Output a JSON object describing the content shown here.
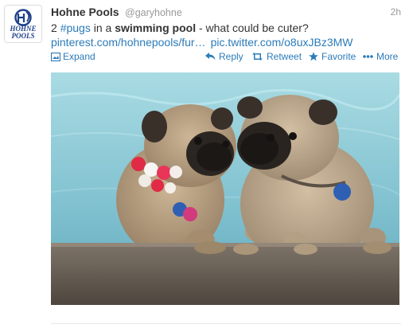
{
  "tweet": {
    "fullname": "Hohne Pools",
    "username": "@garyhohne",
    "timestamp": "2h",
    "avatar_icon": "hohne-pools-logo",
    "avatar_text_line1": "HOHNE",
    "avatar_text_line2": "POOLS",
    "text_prefix": "2 ",
    "hashtag": "#pugs",
    "text_mid": " in a ",
    "text_bold": "swimming pool",
    "text_suffix": " - what could be cuter?",
    "link_url": "pinterest.com/hohnepools/fur…",
    "link_pic": "pic.twitter.com/o8uxJBz3MW",
    "link_color": "#2b7bb9"
  },
  "actions": {
    "expand_label": "Expand",
    "reply_label": "Reply",
    "retweet_label": "Retweet",
    "favorite_label": "Favorite",
    "more_label": "More",
    "expand_icon": "photo-icon",
    "reply_icon": "reply-arrow-icon",
    "retweet_icon": "retweet-icon",
    "favorite_icon": "star-icon",
    "more_icon": "ellipsis-icon"
  },
  "media": {
    "icon": "pugs-in-pool-photo"
  }
}
